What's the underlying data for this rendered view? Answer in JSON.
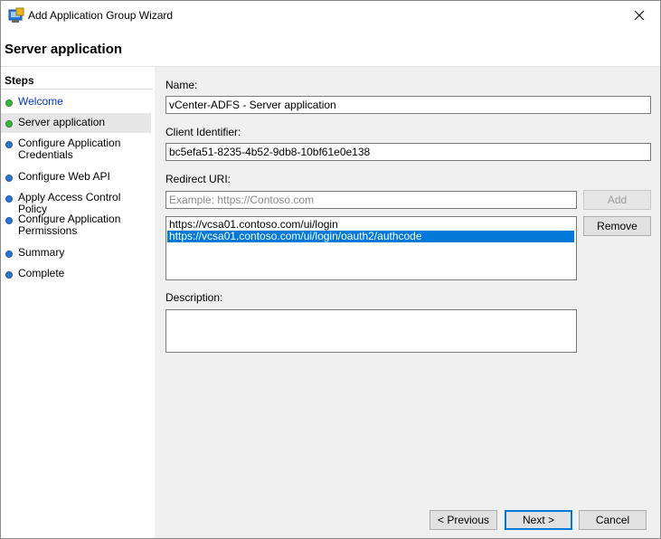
{
  "window": {
    "title": "Add Application Group Wizard",
    "icon": "adfs-app-icon",
    "close_icon": "close-icon"
  },
  "page_title": "Server application",
  "steps": {
    "title": "Steps",
    "items": [
      {
        "label": "Welcome",
        "status": "done",
        "link": true
      },
      {
        "label": "Server application",
        "status": "done",
        "selected": true
      },
      {
        "label": "Configure Application Credentials",
        "status": "todo"
      },
      {
        "label": "Configure Web API",
        "status": "todo"
      },
      {
        "label": "Apply Access Control Policy",
        "status": "todo"
      },
      {
        "label": "Configure Application Permissions",
        "status": "todo"
      },
      {
        "label": "Summary",
        "status": "todo"
      },
      {
        "label": "Complete",
        "status": "todo"
      }
    ]
  },
  "form": {
    "name_label": "Name:",
    "name_value": "vCenter-ADFS - Server application",
    "client_id_label": "Client Identifier:",
    "client_id_value": "bc5efa51-8235-4b52-9db8-10bf61e0e138",
    "redirect_label": "Redirect URI:",
    "redirect_placeholder": "Example: https://Contoso.com",
    "add_label": "Add",
    "remove_label": "Remove",
    "redirect_list": [
      "https://vcsa01.contoso.com/ui/login",
      "https://vcsa01.contoso.com/ui/login/oauth2/authcode"
    ],
    "description_label": "Description:",
    "description_value": ""
  },
  "footer": {
    "previous_label": "< Previous",
    "next_label": "Next >",
    "cancel_label": "Cancel"
  },
  "colors": {
    "done_dot": "#3cb043",
    "todo_dot": "#2f74d0",
    "selection": "#0078d7",
    "panel_bg": "#f0f0f0"
  }
}
